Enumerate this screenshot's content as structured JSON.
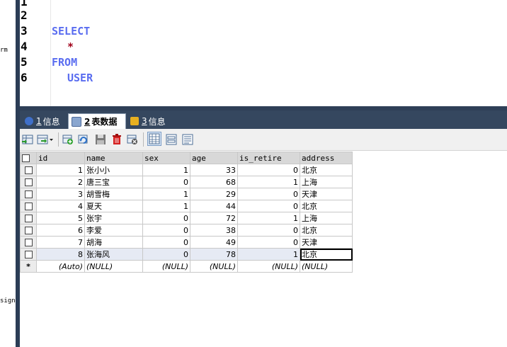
{
  "sidebar_fragments": [
    "rm",
    "sign"
  ],
  "editor": {
    "line_numbers": [
      "1",
      "2",
      "3",
      "4",
      "5",
      "6"
    ],
    "code": {
      "select": "SELECT",
      "star": "*",
      "from": "FROM",
      "table": "USER"
    }
  },
  "tabs": [
    {
      "num": "1",
      "label": "信息"
    },
    {
      "num": "2",
      "label": "表数据"
    },
    {
      "num": "3",
      "label": "信息"
    }
  ],
  "toolbar": {
    "icons": [
      "export-grid-icon",
      "import-dropdown-icon",
      "insert-row-icon",
      "refresh-icon",
      "save-icon",
      "delete-icon",
      "cancel-changes-icon",
      "grid-view-icon",
      "form-view-icon",
      "text-view-icon"
    ]
  },
  "grid": {
    "columns": [
      "id",
      "name",
      "sex",
      "age",
      "is_retire",
      "address"
    ],
    "rows": [
      [
        "1",
        "张小小",
        "1",
        "33",
        "0",
        "北京"
      ],
      [
        "2",
        "唐三宝",
        "0",
        "68",
        "1",
        "上海"
      ],
      [
        "3",
        "胡雪梅",
        "1",
        "29",
        "0",
        "天津"
      ],
      [
        "4",
        "夏天",
        "1",
        "44",
        "0",
        "北京"
      ],
      [
        "5",
        "张宇",
        "0",
        "72",
        "1",
        "上海"
      ],
      [
        "6",
        "李爱",
        "0",
        "38",
        "0",
        "北京"
      ],
      [
        "7",
        "胡海",
        "0",
        "49",
        "0",
        "天津"
      ],
      [
        "8",
        "张海风",
        "0",
        "78",
        "1",
        "北京"
      ]
    ],
    "new_row_marker": "*",
    "new_row": [
      "(Auto)",
      "(NULL)",
      "(NULL)",
      "(NULL)",
      "(NULL)",
      "(NULL)"
    ]
  }
}
